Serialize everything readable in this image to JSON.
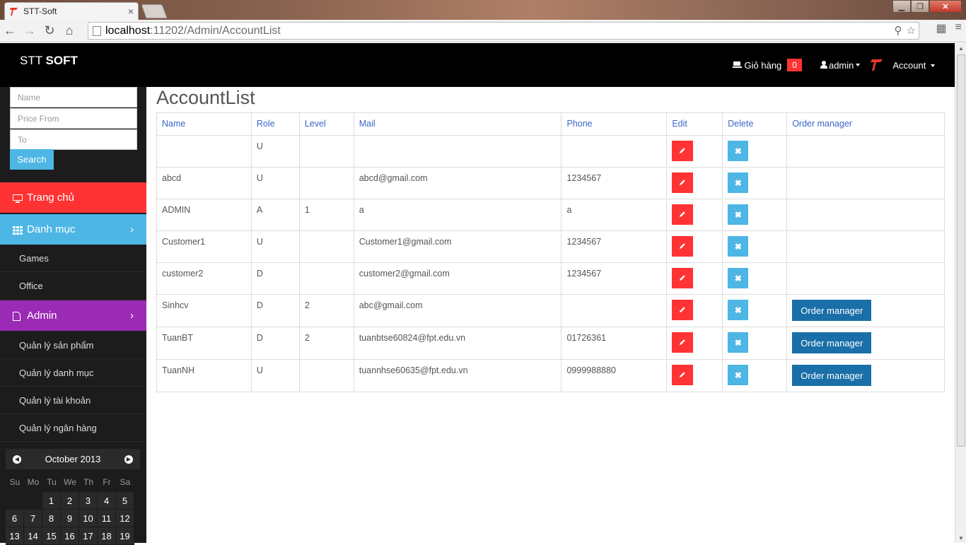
{
  "browser": {
    "tab_title": "STT-Soft",
    "tab_close": "×",
    "url_host": "localhost",
    "url_rest": ":11202/Admin/AccountList"
  },
  "header": {
    "brand_light": "STT ",
    "brand_bold": "SOFT",
    "cart_label": "Giỏ hàng",
    "cart_count": "0",
    "admin_label": "admin",
    "account_label": "Account"
  },
  "sidebar": {
    "search_name_placeholder": "Name",
    "search_price_from_placeholder": "Price From",
    "search_to_placeholder": "To",
    "search_button": "Search",
    "menu": {
      "home": "Trang chủ",
      "category": "Danh mục",
      "games": "Games",
      "office": "Office",
      "admin": "Admin",
      "manage_products": "Quản lý sản phẩm",
      "manage_categories": "Quản lý danh mục",
      "manage_accounts": "Quản lý tài khoản",
      "manage_banks": "Quản lý ngân hàng"
    },
    "colors": {
      "home": "#ff3333",
      "category": "#4db6e4",
      "admin": "#9b2bb5"
    }
  },
  "calendar": {
    "month": "October 2013",
    "days_of_week": [
      "Su",
      "Mo",
      "Tu",
      "We",
      "Th",
      "Fr",
      "Sa"
    ],
    "week1": [
      "",
      "",
      "1",
      "2",
      "3",
      "4",
      "5"
    ],
    "week2": [
      "6",
      "7",
      "8",
      "9",
      "10",
      "11",
      "12"
    ],
    "week3": [
      "13",
      "14",
      "15",
      "16",
      "17",
      "18",
      "19"
    ]
  },
  "main": {
    "title": "AccountList",
    "columns": [
      "Name",
      "Role",
      "Level",
      "Mail",
      "Phone",
      "Edit",
      "Delete",
      "Order manager"
    ],
    "order_button_label": "Order manager",
    "rows": [
      {
        "name": "",
        "role": "U",
        "level": "",
        "mail": "",
        "phone": "",
        "order": false
      },
      {
        "name": "abcd",
        "role": "U",
        "level": "",
        "mail": "abcd@gmail.com",
        "phone": "1234567",
        "order": false
      },
      {
        "name": "ADMIN",
        "role": "A",
        "level": "1",
        "mail": "a",
        "phone": "a",
        "order": false
      },
      {
        "name": "Customer1",
        "role": "U",
        "level": "",
        "mail": "Customer1@gmail.com",
        "phone": "1234567",
        "order": false
      },
      {
        "name": "customer2",
        "role": "D",
        "level": "",
        "mail": "customer2@gmail.com",
        "phone": "1234567",
        "order": false
      },
      {
        "name": "Sinhcv",
        "role": "D",
        "level": "2",
        "mail": "abc@gmail.com",
        "phone": "",
        "order": true
      },
      {
        "name": "TuanBT",
        "role": "D",
        "level": "2",
        "mail": "tuanbtse60824@fpt.edu.vn",
        "phone": "01726361",
        "order": true
      },
      {
        "name": "TuanNH",
        "role": "U",
        "level": "",
        "mail": "tuannhse60635@fpt.edu.vn",
        "phone": "0999988880",
        "order": true
      }
    ]
  }
}
